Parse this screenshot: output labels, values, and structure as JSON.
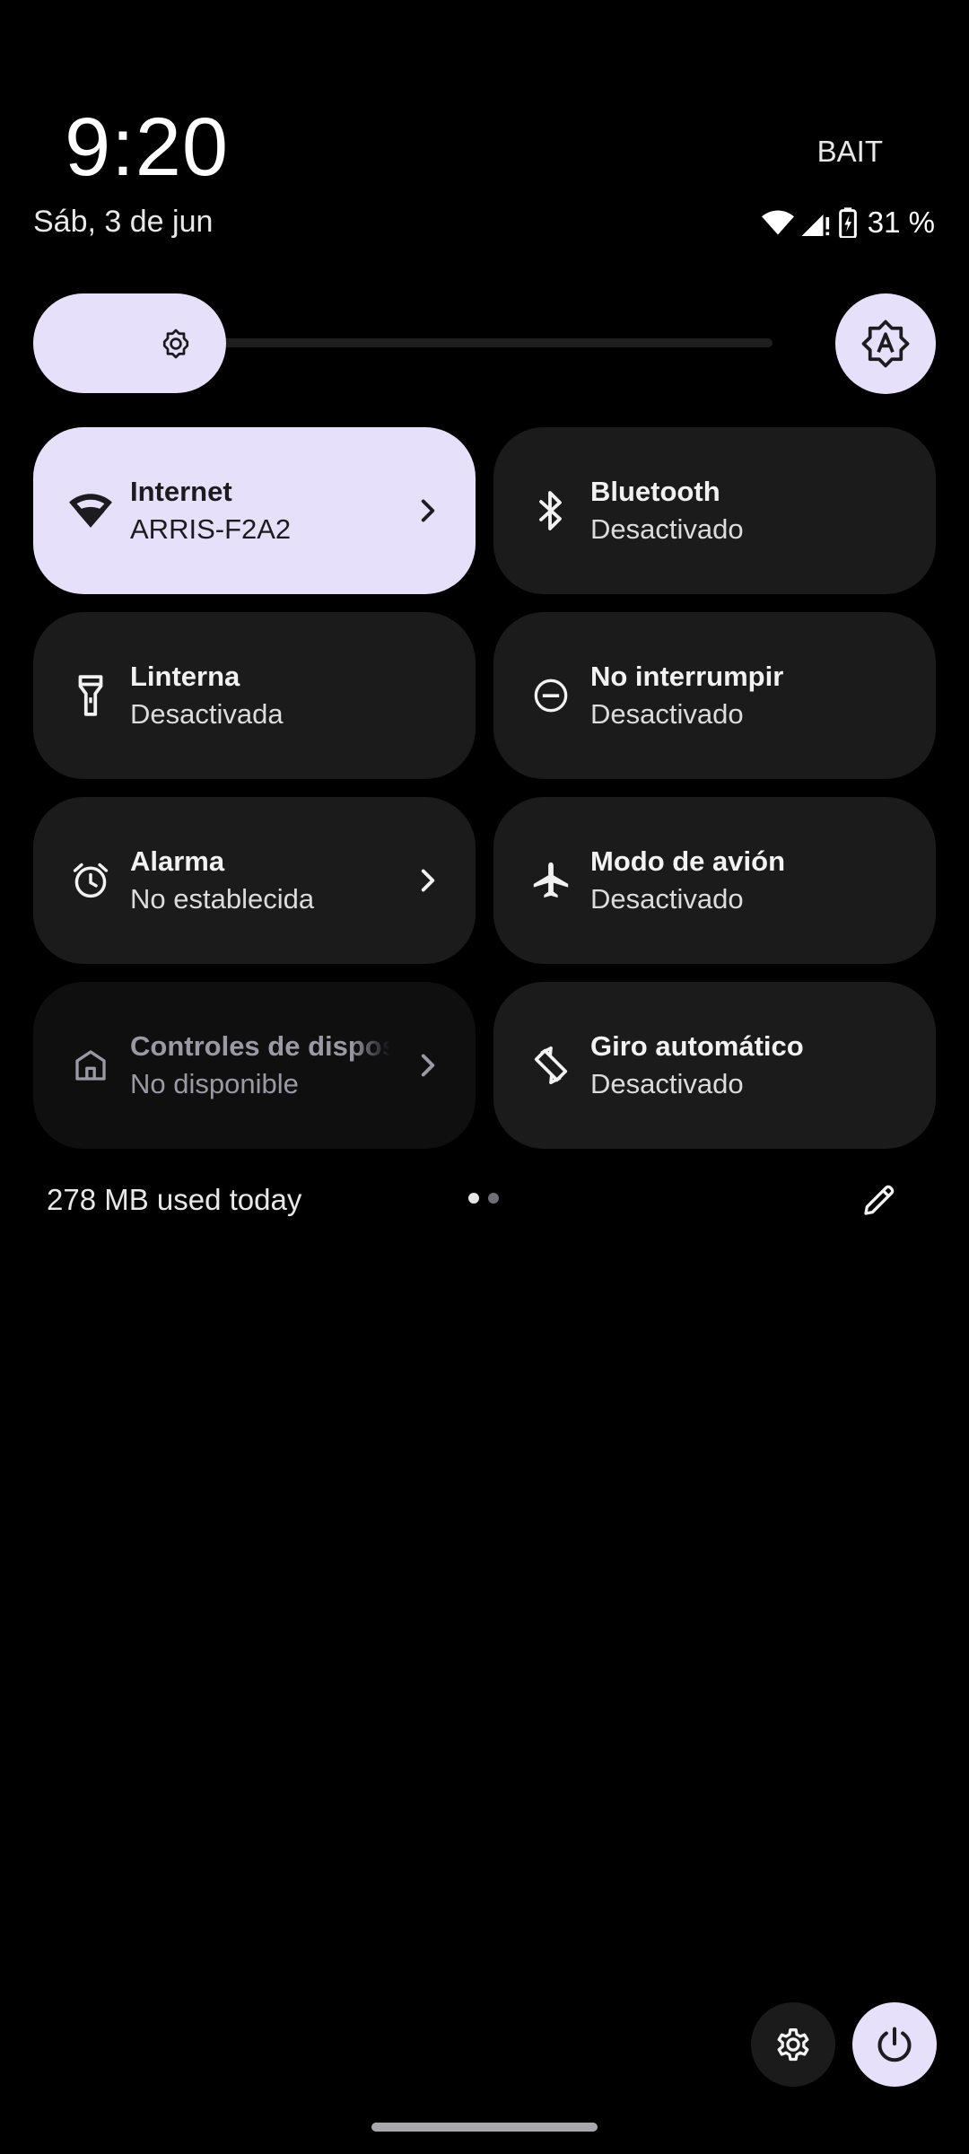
{
  "header": {
    "time": "9:20",
    "date": "Sáb, 3 de jun",
    "carrier": "BAIT",
    "battery_percent": "31 %"
  },
  "brightness": {
    "level": 0.2
  },
  "tiles": [
    {
      "title": "Internet",
      "subtitle": "ARRIS-F2A2",
      "icon": "wifi-icon",
      "state": "on",
      "has_chevron": true
    },
    {
      "title": "Bluetooth",
      "subtitle": "Desactivado",
      "icon": "bluetooth-icon",
      "state": "off",
      "has_chevron": false
    },
    {
      "title": "Linterna",
      "subtitle": "Desactivada",
      "icon": "flashlight-icon",
      "state": "off",
      "has_chevron": false
    },
    {
      "title": "No interrumpir",
      "subtitle": "Desactivado",
      "icon": "do-not-disturb-icon",
      "state": "off",
      "has_chevron": false
    },
    {
      "title": "Alarma",
      "subtitle": "No establecida",
      "icon": "alarm-icon",
      "state": "off",
      "has_chevron": true
    },
    {
      "title": "Modo de avión",
      "subtitle": "Desactivado",
      "icon": "airplane-icon",
      "state": "off",
      "has_chevron": false
    },
    {
      "title": "Controles de dispositivos",
      "subtitle": "No disponible",
      "icon": "home-icon",
      "state": "unavailable",
      "has_chevron": true
    },
    {
      "title": "Giro automático",
      "subtitle": "Desactivado",
      "icon": "auto-rotate-icon",
      "state": "off",
      "has_chevron": false
    }
  ],
  "footer": {
    "data_usage": "278 MB used today",
    "page_count": 2,
    "current_page": 1
  },
  "colors": {
    "accent": "#e6e0fb",
    "tile_off": "#1b1b1c",
    "background": "#000000"
  }
}
